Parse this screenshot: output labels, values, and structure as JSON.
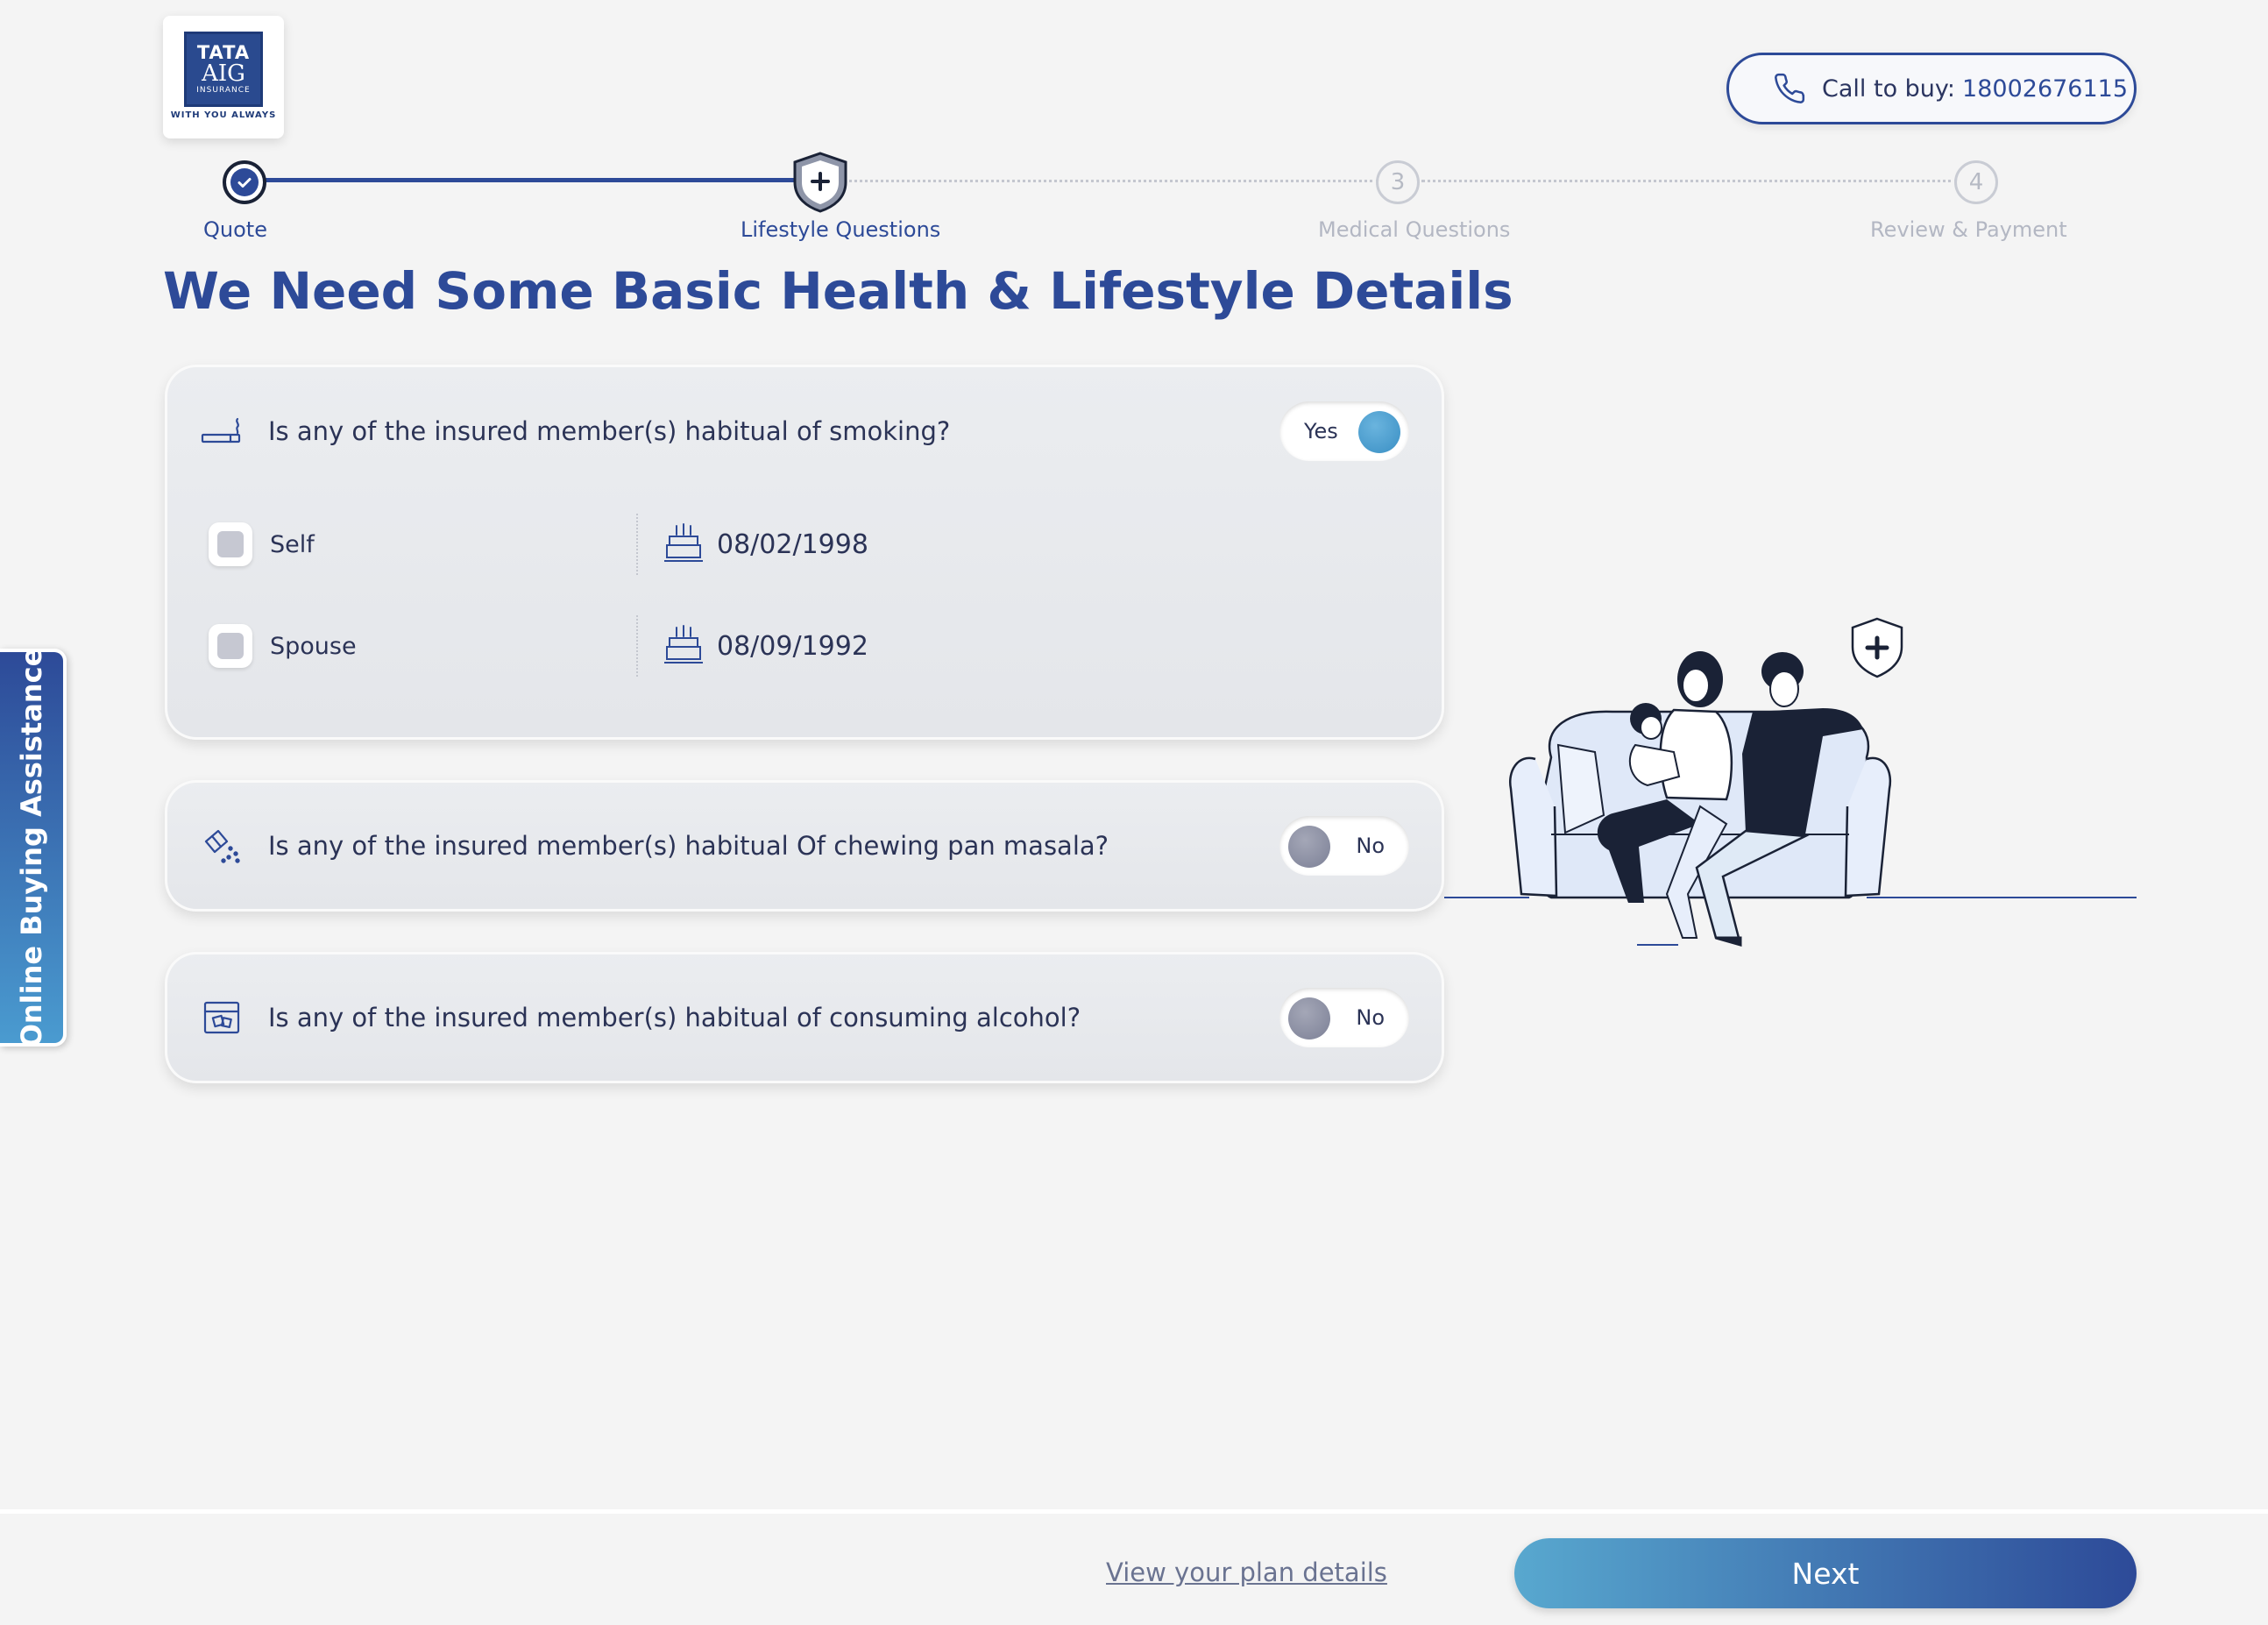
{
  "brand": {
    "logo_line1": "TATA",
    "logo_line2": "AIG",
    "logo_line3": "INSURANCE",
    "tagline": "WITH YOU ALWAYS",
    "primary_color": "#2d4a98",
    "accent_color": "#58a8cf"
  },
  "header": {
    "call_label": "Call to buy:",
    "call_number": "18002676115"
  },
  "stepper": {
    "steps": [
      {
        "label": "Quote",
        "number": "1",
        "state": "done"
      },
      {
        "label": "Lifestyle Questions",
        "number": "2",
        "state": "active"
      },
      {
        "label": "Medical Questions",
        "number": "3",
        "state": "todo"
      },
      {
        "label": "Review & Payment",
        "number": "4",
        "state": "todo"
      }
    ]
  },
  "page_title": "We Need Some Basic Health & Lifestyle Details",
  "questions": [
    {
      "icon": "cigarette-icon",
      "text": "Is any of the insured member(s) habitual of smoking?",
      "answer": "Yes",
      "members": [
        {
          "name": "Self",
          "dob": "08/02/1998"
        },
        {
          "name": "Spouse",
          "dob": "08/09/1992"
        }
      ]
    },
    {
      "icon": "pan-masala-icon",
      "text": "Is any of the insured member(s) habitual Of chewing pan masala?",
      "answer": "No"
    },
    {
      "icon": "alcohol-icon",
      "text": "Is any of the insured member(s) habitual of consuming alcohol?",
      "answer": "No"
    }
  ],
  "side_tab": {
    "label": "Online Buying Assistance"
  },
  "footer": {
    "plan_link": "View your plan details",
    "next_label": "Next"
  }
}
